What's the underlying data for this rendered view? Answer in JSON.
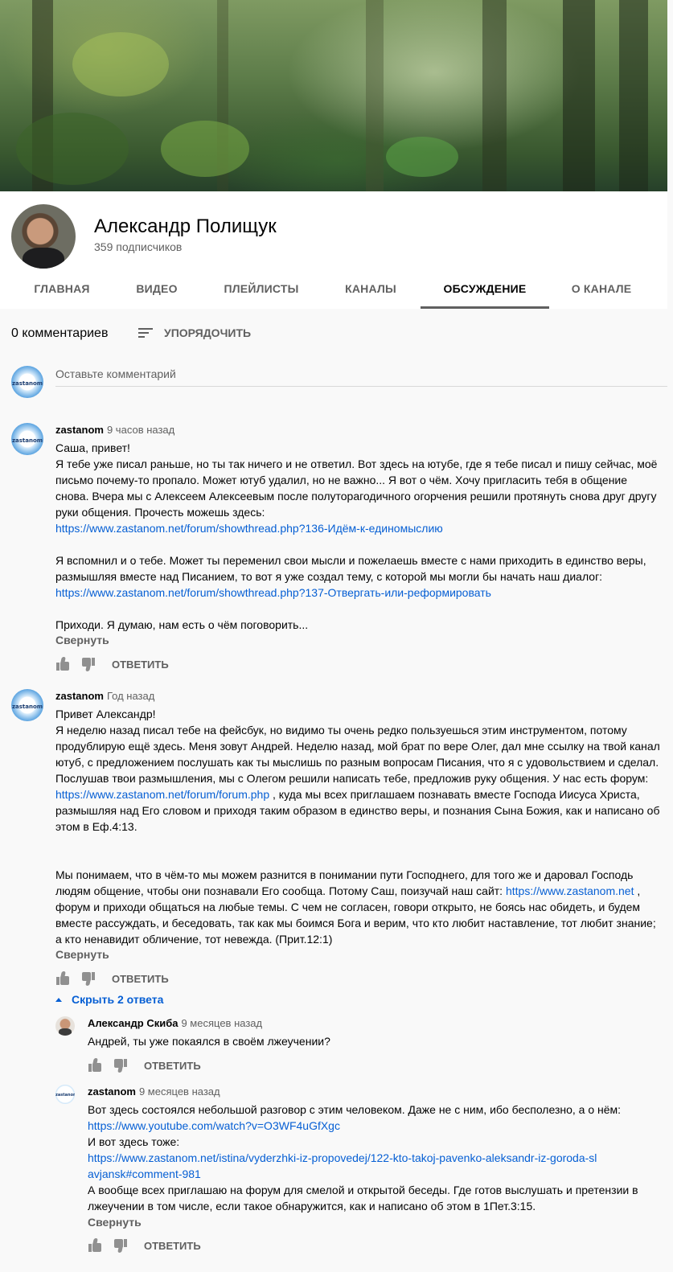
{
  "channel": {
    "name": "Александр Полищук",
    "subscribers": "359 подписчиков"
  },
  "tabs": [
    {
      "label": "ГЛАВНАЯ"
    },
    {
      "label": "ВИДЕО"
    },
    {
      "label": "ПЛЕЙЛИСТЫ"
    },
    {
      "label": "КАНАЛЫ"
    },
    {
      "label": "ОБСУЖДЕНИЕ"
    },
    {
      "label": "О КАНАЛЕ"
    }
  ],
  "active_tab": "ОБСУЖДЕНИЕ",
  "comments_header": {
    "count": "0 комментариев",
    "sort_label": "УПОРЯДОЧИТЬ"
  },
  "reply_box": {
    "placeholder": "Оставьте комментарий"
  },
  "actions": {
    "reply_label": "ОТВЕТИТЬ",
    "collapse_label": "Свернуть",
    "hide_replies_label": "Скрыть 2 ответа"
  },
  "comments": [
    {
      "author": "zastanom",
      "time": "9 часов назад",
      "lines": {
        "l1": "Саша, привет!",
        "l2": "Я тебе уже писал раньше, но ты так ничего и не ответил. Вот здесь на ютубе, где я тебе писал и пишу сейчас, моё письмо почему-то пропало. Может ютуб удалил, но не важно... Я вот о чём. Хочу пригласить тебя в общение снова. Вчера мы с Алексеем Алексеевым после полуторагодичного огорчения решили протянуть снова друг другу руки общения. Прочесть можешь здесь:",
        "link1": "https://www.zastanom.net/forum/showthread.php?136-Идём-к-единомыслию",
        "l3": "Я вспомнил и о тебе. Может ты переменил свои мысли и пожелаешь вместе с нами приходить в единство веры, размышляя вместе над Писанием, то вот я уже создал тему, с которой мы могли бы начать наш диалог:",
        "link2": "https://www.zastanom.net/forum/showthread.php?137-Отвергать-или-реформировать",
        "l4": "Приходи. Я думаю, нам есть о чём поговорить..."
      }
    },
    {
      "author": "zastanom",
      "time": "Год назад",
      "lines": {
        "l1": "Привет Александр!",
        "l2a": "Я неделю назад писал тебе на фейсбук, но видимо ты очень редко пользуешься этим инструментом, потому продублирую ещё здесь. Меня зовут Андрей. Неделю назад, мой брат по вере Олег, дал мне ссылку на твой канал ютуб, с предложением послушать как ты мыслишь по разным вопросам Писания, что я с удовольствием и сделал. Послушав твои размышления, мы с Олегом решили написать тебе, предложив руку общения. У нас есть форум:",
        "link1": "https://www.zastanom.net/forum/forum.php",
        "l2b": ", куда мы всех приглашаем познавать вместе Господа Иисуса Христа, размышляя над Его словом и приходя таким образом в единство веры, и познания Сына Божия, как и написано об этом в Еф.4:13.",
        "l3a": "Мы понимаем, что в чём-то мы можем разнится в понимании пути Господнего, для того же и даровал Господь людям общение, чтобы они познавали Его сообща. Потому Саш, поизучай наш сайт:",
        "link2": "https://www.zastanom.net",
        "l3b": ", форум и приходи общаться на любые темы. С чем не согласен, говори открыто, не боясь нас обидеть, и будем вместе рассуждать, и беседовать, так как мы боимся Бога и верим, что кто любит наставление, тот любит знание; а кто ненавидит обличение, тот невежда. (Прит.12:1)"
      },
      "replies": [
        {
          "author": "Александр Скиба",
          "time": "9 месяцев назад",
          "text": "Андрей, ты уже покаялся в своём лжеучении?"
        },
        {
          "author": "zastanom",
          "time": "9 месяцев назад",
          "lines": {
            "l1": "Вот здесь состоялся небольшой разговор с этим человеком. Даже не с ним, ибо бесполезно, а о нём:",
            "link1": "https://www.youtube.com/watch?v=O3WF4uGfXgc",
            "l2": "И вот здесь тоже:",
            "link2": "https://www.zastanom.net/istina/vyderzhki-iz-propovedej/122-kto-takoj-pavenko-aleksandr-iz-goroda-slavjansk#comment-981",
            "l3": "А вообще всех приглашаю на форум для смелой и открытой беседы. Где готов выслушать и претензии в лжеучении в том числе, если такое обнаружится, как и написано об этом в 1Пет.3:15."
          }
        }
      ]
    }
  ],
  "logo_text": "zastanom",
  "colors": {
    "link": "#065fd4",
    "secondary_text": "#606060",
    "header_bg": "#ffffff",
    "page_bg": "#f9f9f9"
  }
}
